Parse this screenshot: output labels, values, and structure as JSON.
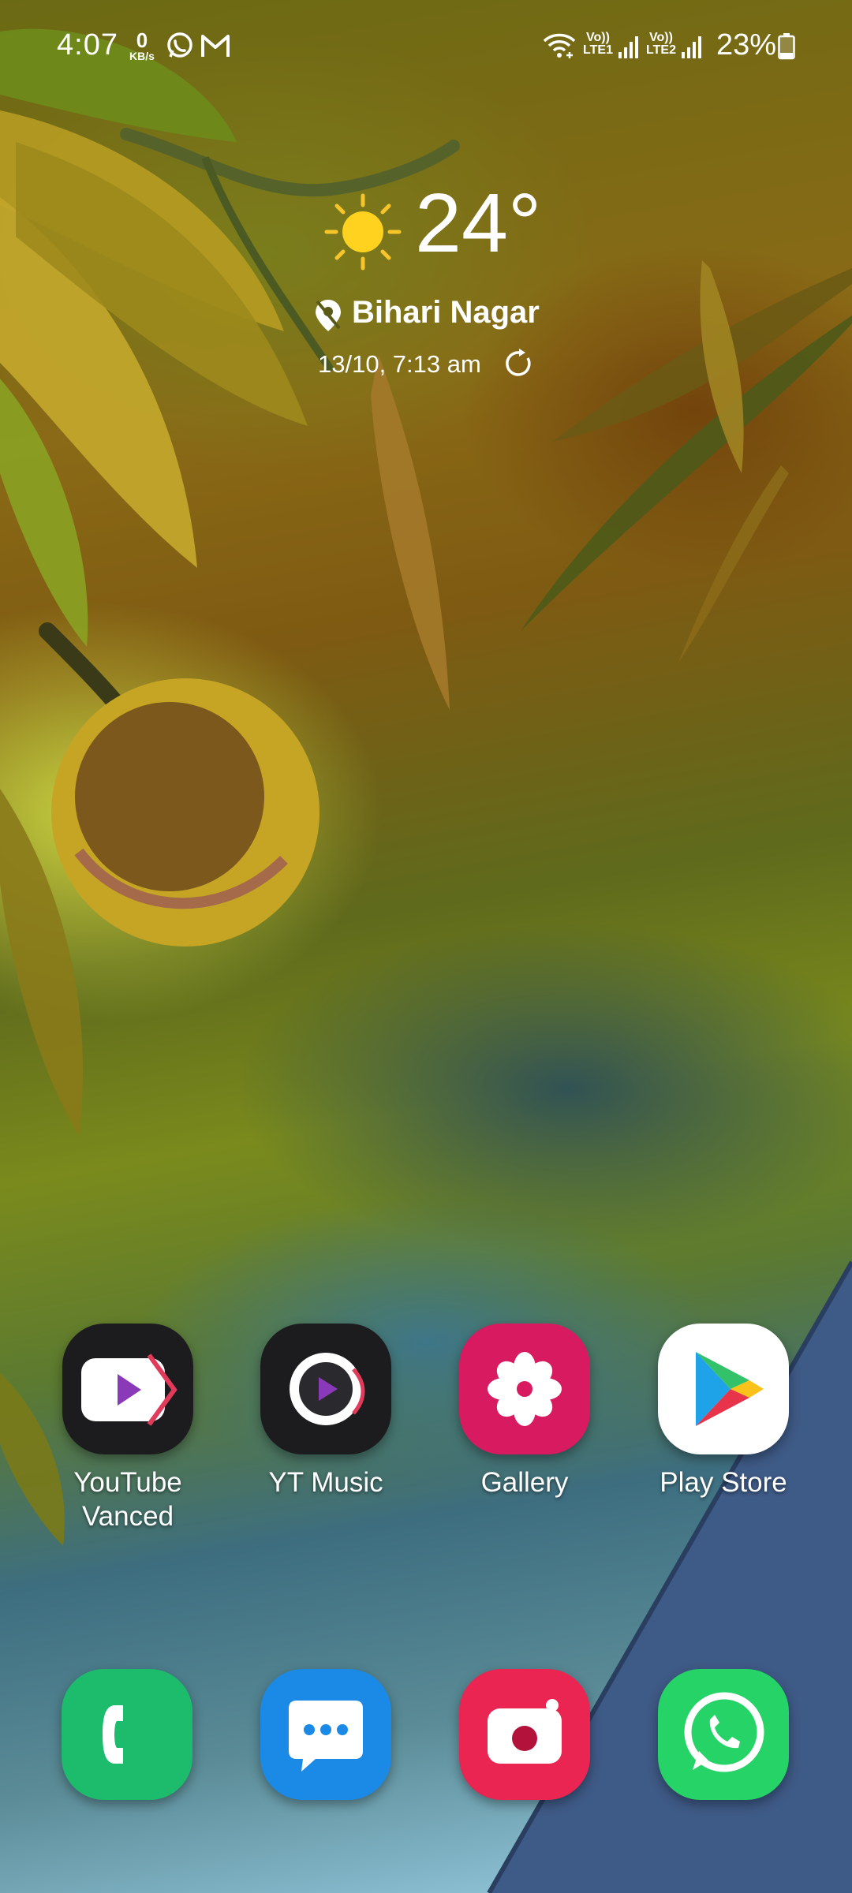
{
  "status_bar": {
    "time": "4:07",
    "net_speed_value": "0",
    "net_speed_unit": "KB/s",
    "notification_icons": [
      "whatsapp-icon",
      "gmail-icon"
    ],
    "sim1_label": "LTE1",
    "sim2_label": "LTE2",
    "volte_label": "Vo))",
    "battery_percent": "23%",
    "battery_level": 0.23
  },
  "weather": {
    "condition_icon": "sun-icon",
    "temperature": "24°",
    "location": "Bihari Nagar",
    "updated": "13/10, 7:13 am"
  },
  "home_apps": [
    {
      "label_line1": "YouTube",
      "label_line2": "Vanced",
      "icon": "youtube-vanced-icon",
      "color": "#1c1c1e"
    },
    {
      "label_line1": "YT Music",
      "label_line2": "",
      "icon": "yt-music-icon",
      "color": "#1c1c1e"
    },
    {
      "label_line1": "Gallery",
      "label_line2": "",
      "icon": "gallery-icon",
      "color": "#d81b60"
    },
    {
      "label_line1": "Play Store",
      "label_line2": "",
      "icon": "play-store-icon",
      "color": "#ffffff"
    }
  ],
  "dock_apps": [
    {
      "icon": "phone-icon",
      "color": "#1dbb6c"
    },
    {
      "icon": "messages-icon",
      "color": "#1a8ae6"
    },
    {
      "icon": "camera-icon",
      "color": "#ea2552"
    },
    {
      "icon": "whatsapp-icon",
      "color": "#25d366"
    }
  ]
}
